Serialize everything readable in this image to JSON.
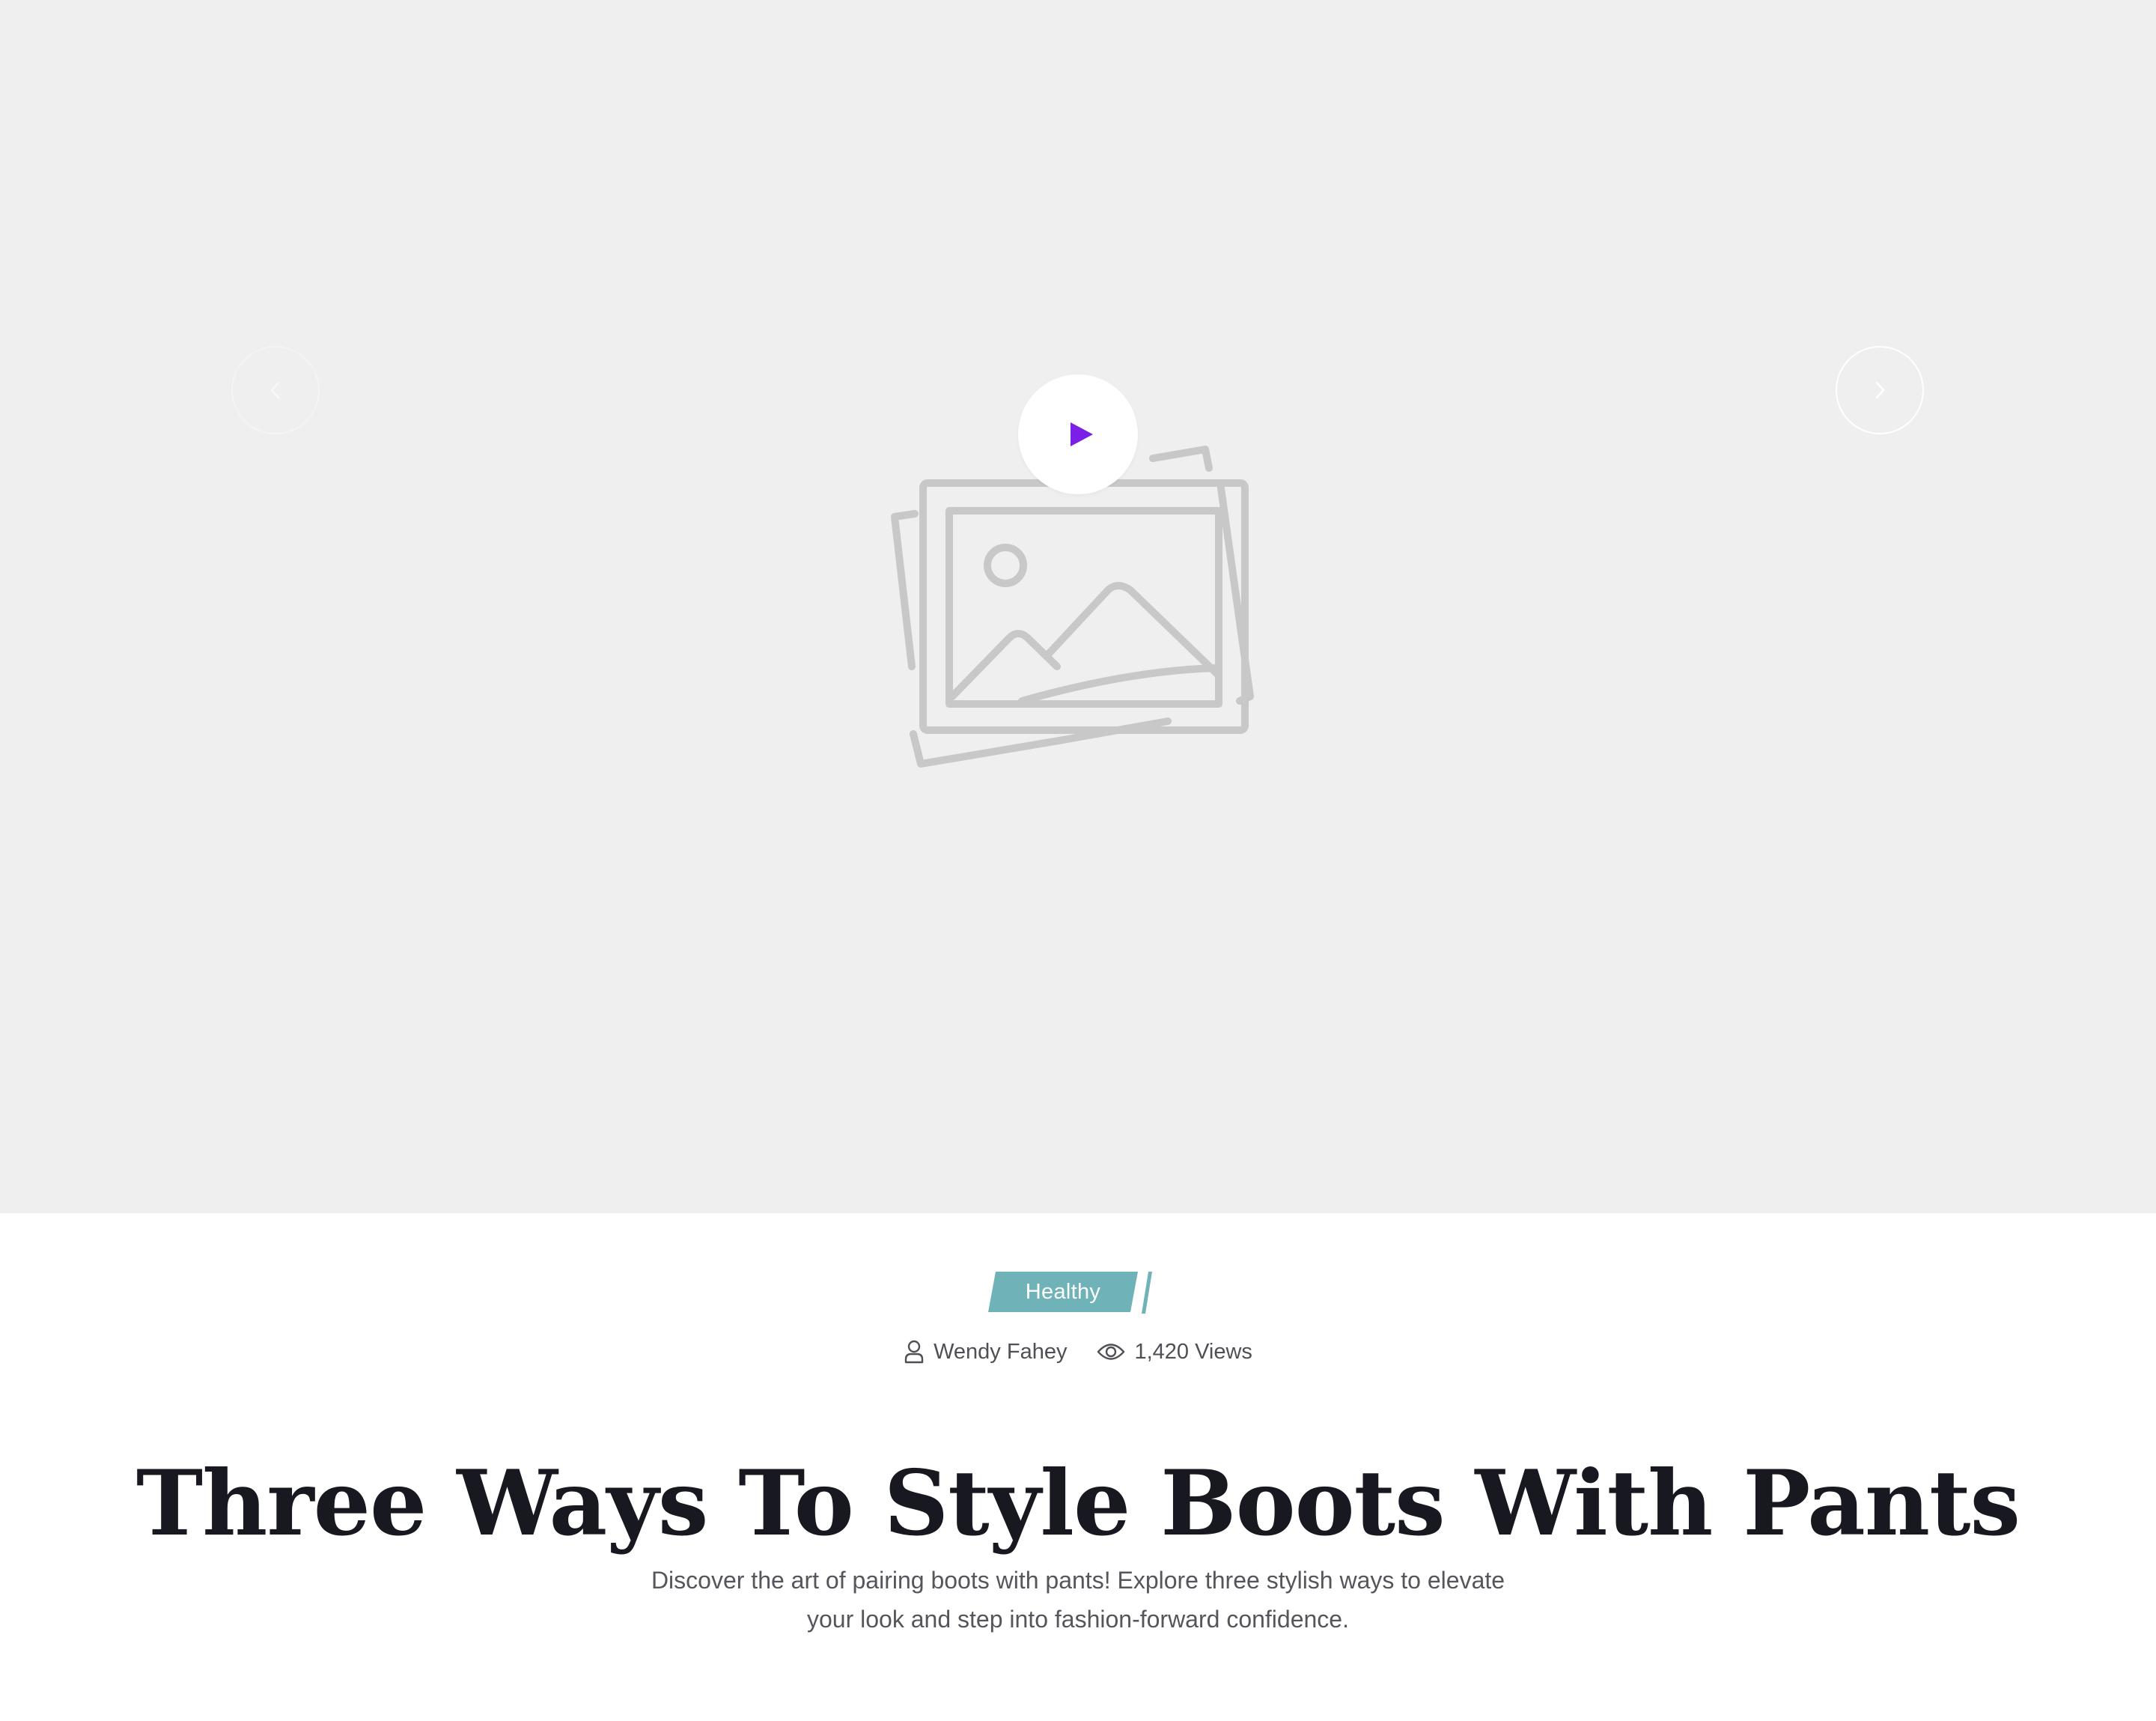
{
  "hero": {
    "background_color": "#efefef",
    "play_button": {
      "icon": "play-icon",
      "icon_color": "#7b1fe6"
    },
    "prev_arrow": {
      "icon": "chevron-left-icon"
    },
    "next_arrow": {
      "icon": "chevron-right-icon"
    },
    "placeholder": {
      "icon": "image-placeholder-icon"
    }
  },
  "post": {
    "category": "Healthy",
    "category_color": "#6fb3b8",
    "author": "Wendy Fahey",
    "views": "1,420 Views",
    "title": "Three Ways To Style Boots With Pants",
    "excerpt": "Discover the art of pairing boots with pants! Explore three stylish ways to elevate your look and step into fashion-forward confidence."
  }
}
